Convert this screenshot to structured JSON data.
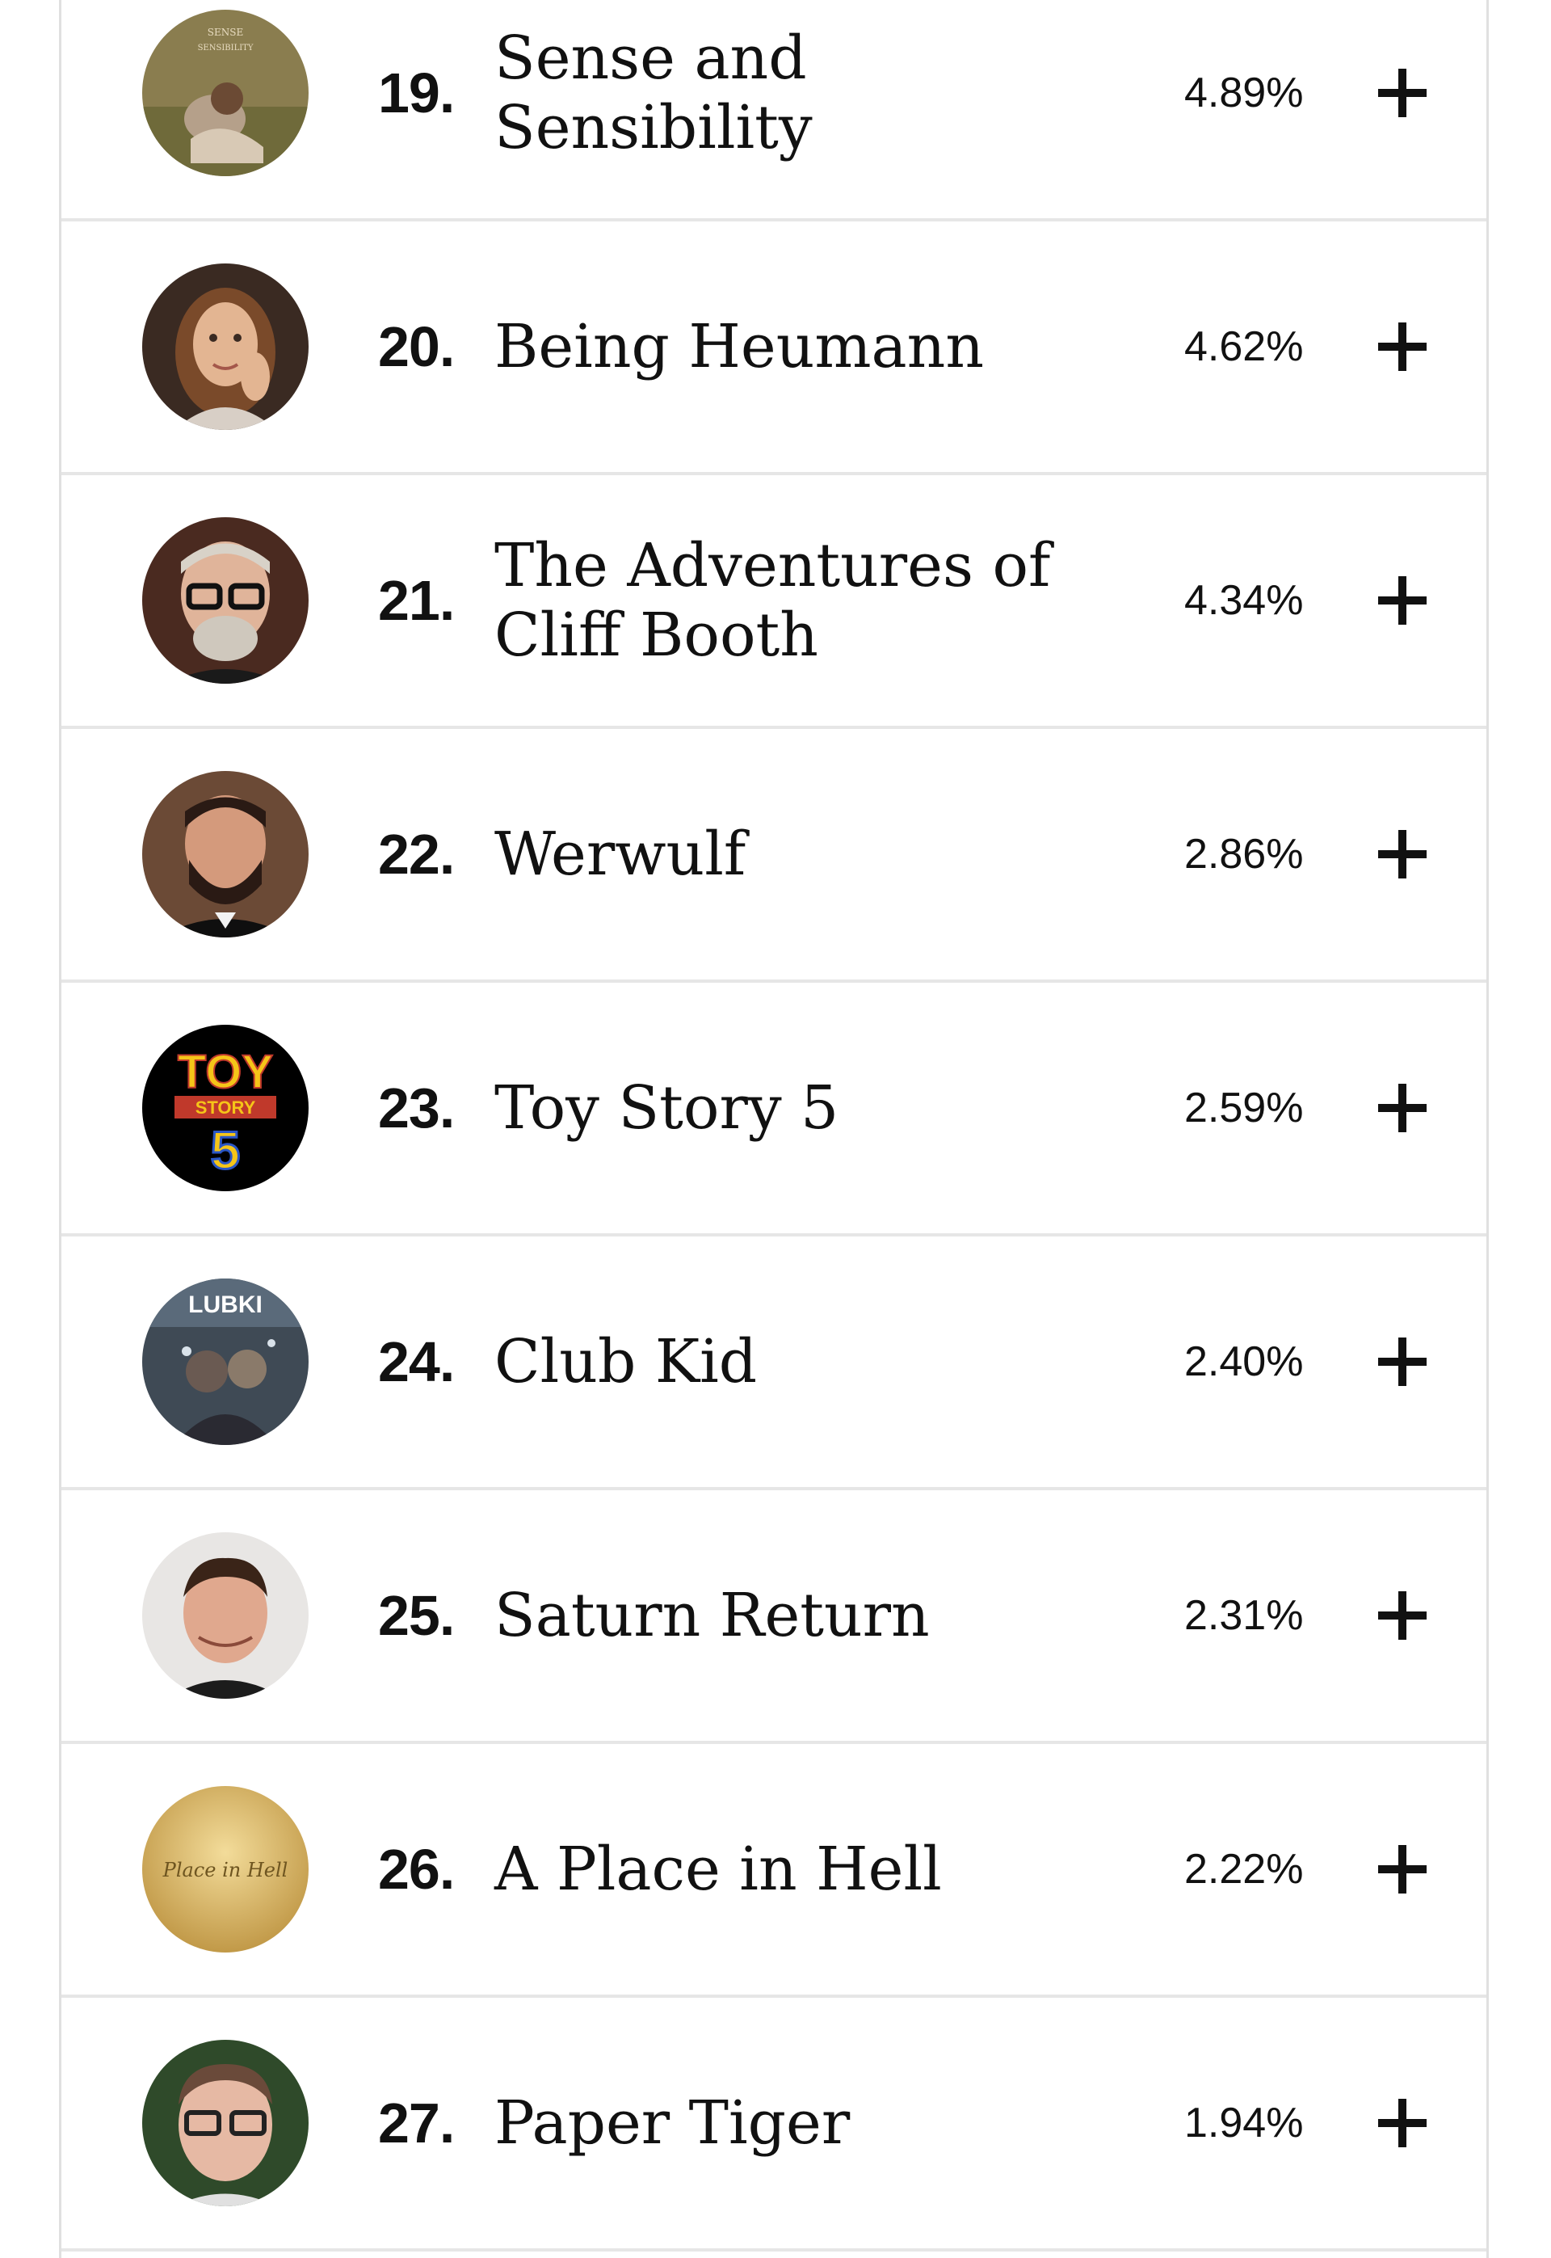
{
  "rankings": [
    {
      "rank": "19.",
      "title": "Sense and Sensibility",
      "percent": "4.89%",
      "avatar": "film-poster-woman-in-field",
      "avatar_text": "Sense and Sensibility"
    },
    {
      "rank": "20.",
      "title": "Being Heumann",
      "percent": "4.62%",
      "avatar": "woman-portrait"
    },
    {
      "rank": "21.",
      "title": "The Adventures of Cliff Booth",
      "percent": "4.34%",
      "avatar": "man-glasses-portrait"
    },
    {
      "rank": "22.",
      "title": "Werwulf",
      "percent": "2.86%",
      "avatar": "bearded-man-portrait"
    },
    {
      "rank": "23.",
      "title": "Toy Story 5",
      "percent": "2.59%",
      "avatar": "toy-story-logo",
      "avatar_text": [
        "TOY",
        "STORY",
        "5"
      ]
    },
    {
      "rank": "24.",
      "title": "Club Kid",
      "percent": "2.40%",
      "avatar": "club-kid-poster",
      "avatar_text": "LUBKI"
    },
    {
      "rank": "25.",
      "title": "Saturn Return",
      "percent": "2.31%",
      "avatar": "man-portrait"
    },
    {
      "rank": "26.",
      "title": "A Place in Hell",
      "percent": "2.22%",
      "avatar": "gold-poster",
      "avatar_text": "Place in Hell"
    },
    {
      "rank": "27.",
      "title": "Paper Tiger",
      "percent": "1.94%",
      "avatar": "man-glasses-portrait"
    }
  ],
  "icons": {
    "add": "plus-icon"
  },
  "colors": {
    "text": "#111111",
    "divider": "#e6e6e6",
    "background": "#ffffff"
  }
}
